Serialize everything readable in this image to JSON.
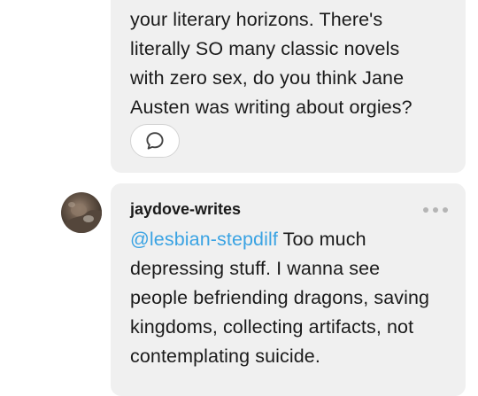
{
  "comments": [
    {
      "lines": [
        "your literary horizons. There's",
        "literally SO many classic novels",
        "with zero sex, do you think Jane",
        "Austen was writing about orgies?"
      ],
      "reply_icon": "speech-bubble-icon"
    },
    {
      "username": "jaydove-writes",
      "mention": "@lesbian-stepdilf",
      "lines": [
        " Too much",
        "depressing stuff. I wanna see",
        "people befriending dragons, saving",
        "kingdoms, collecting artifacts, not",
        "contemplating suicide."
      ],
      "avatar_icon": "user-avatar",
      "more_icon": "ellipsis-icon"
    }
  ],
  "colors": {
    "bubble": "#f0f0f0",
    "mention": "#3aa3e3",
    "text": "#1a1a1a",
    "ellipsis": "#b5b5b5"
  }
}
